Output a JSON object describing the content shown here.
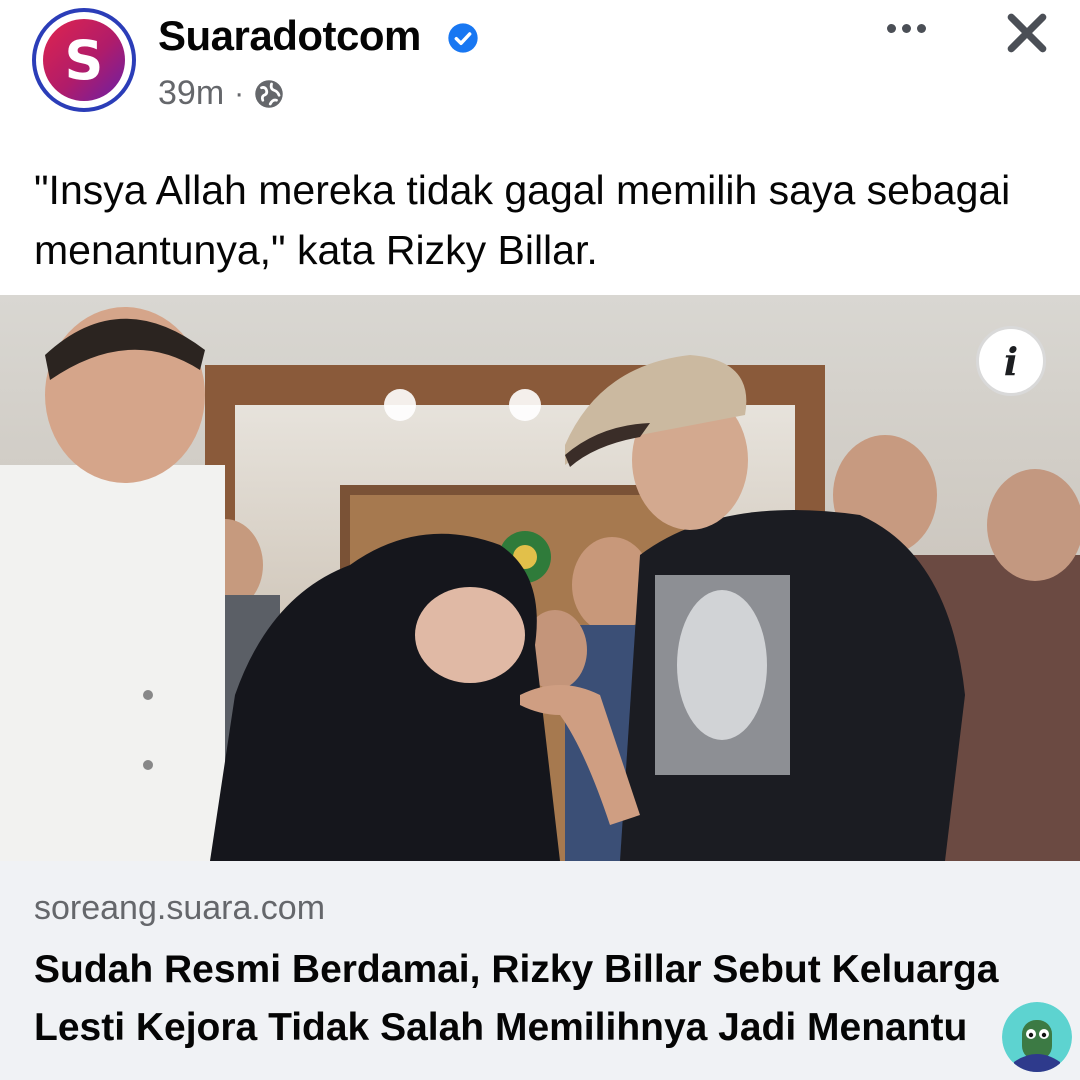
{
  "post": {
    "page_name": "Suaradotcom",
    "avatar_letter": "S",
    "time": "39m",
    "separator": "·",
    "audience_icon": "globe-icon",
    "verified_icon": "verified-badge-icon",
    "caption": "\"Insya Allah mereka tidak gagal memilih saya sebagai menantunya,\" kata Rizky Billar."
  },
  "actions": {
    "more_icon": "more-options-icon",
    "close_icon": "close-icon",
    "info_label": "i"
  },
  "link_preview": {
    "domain": "soreang.suara.com",
    "headline": "Sudah Resmi Berdamai, Rizky Billar Sebut Keluarga Lesti Kejora Tidak Salah Memilihnya Jadi Menantu"
  },
  "colors": {
    "brand_gradient_start": "#e0244d",
    "brand_gradient_end": "#6a1fa6",
    "verified_blue": "#1877f2",
    "secondary_text": "#65676b",
    "link_background": "#f0f2f5"
  }
}
